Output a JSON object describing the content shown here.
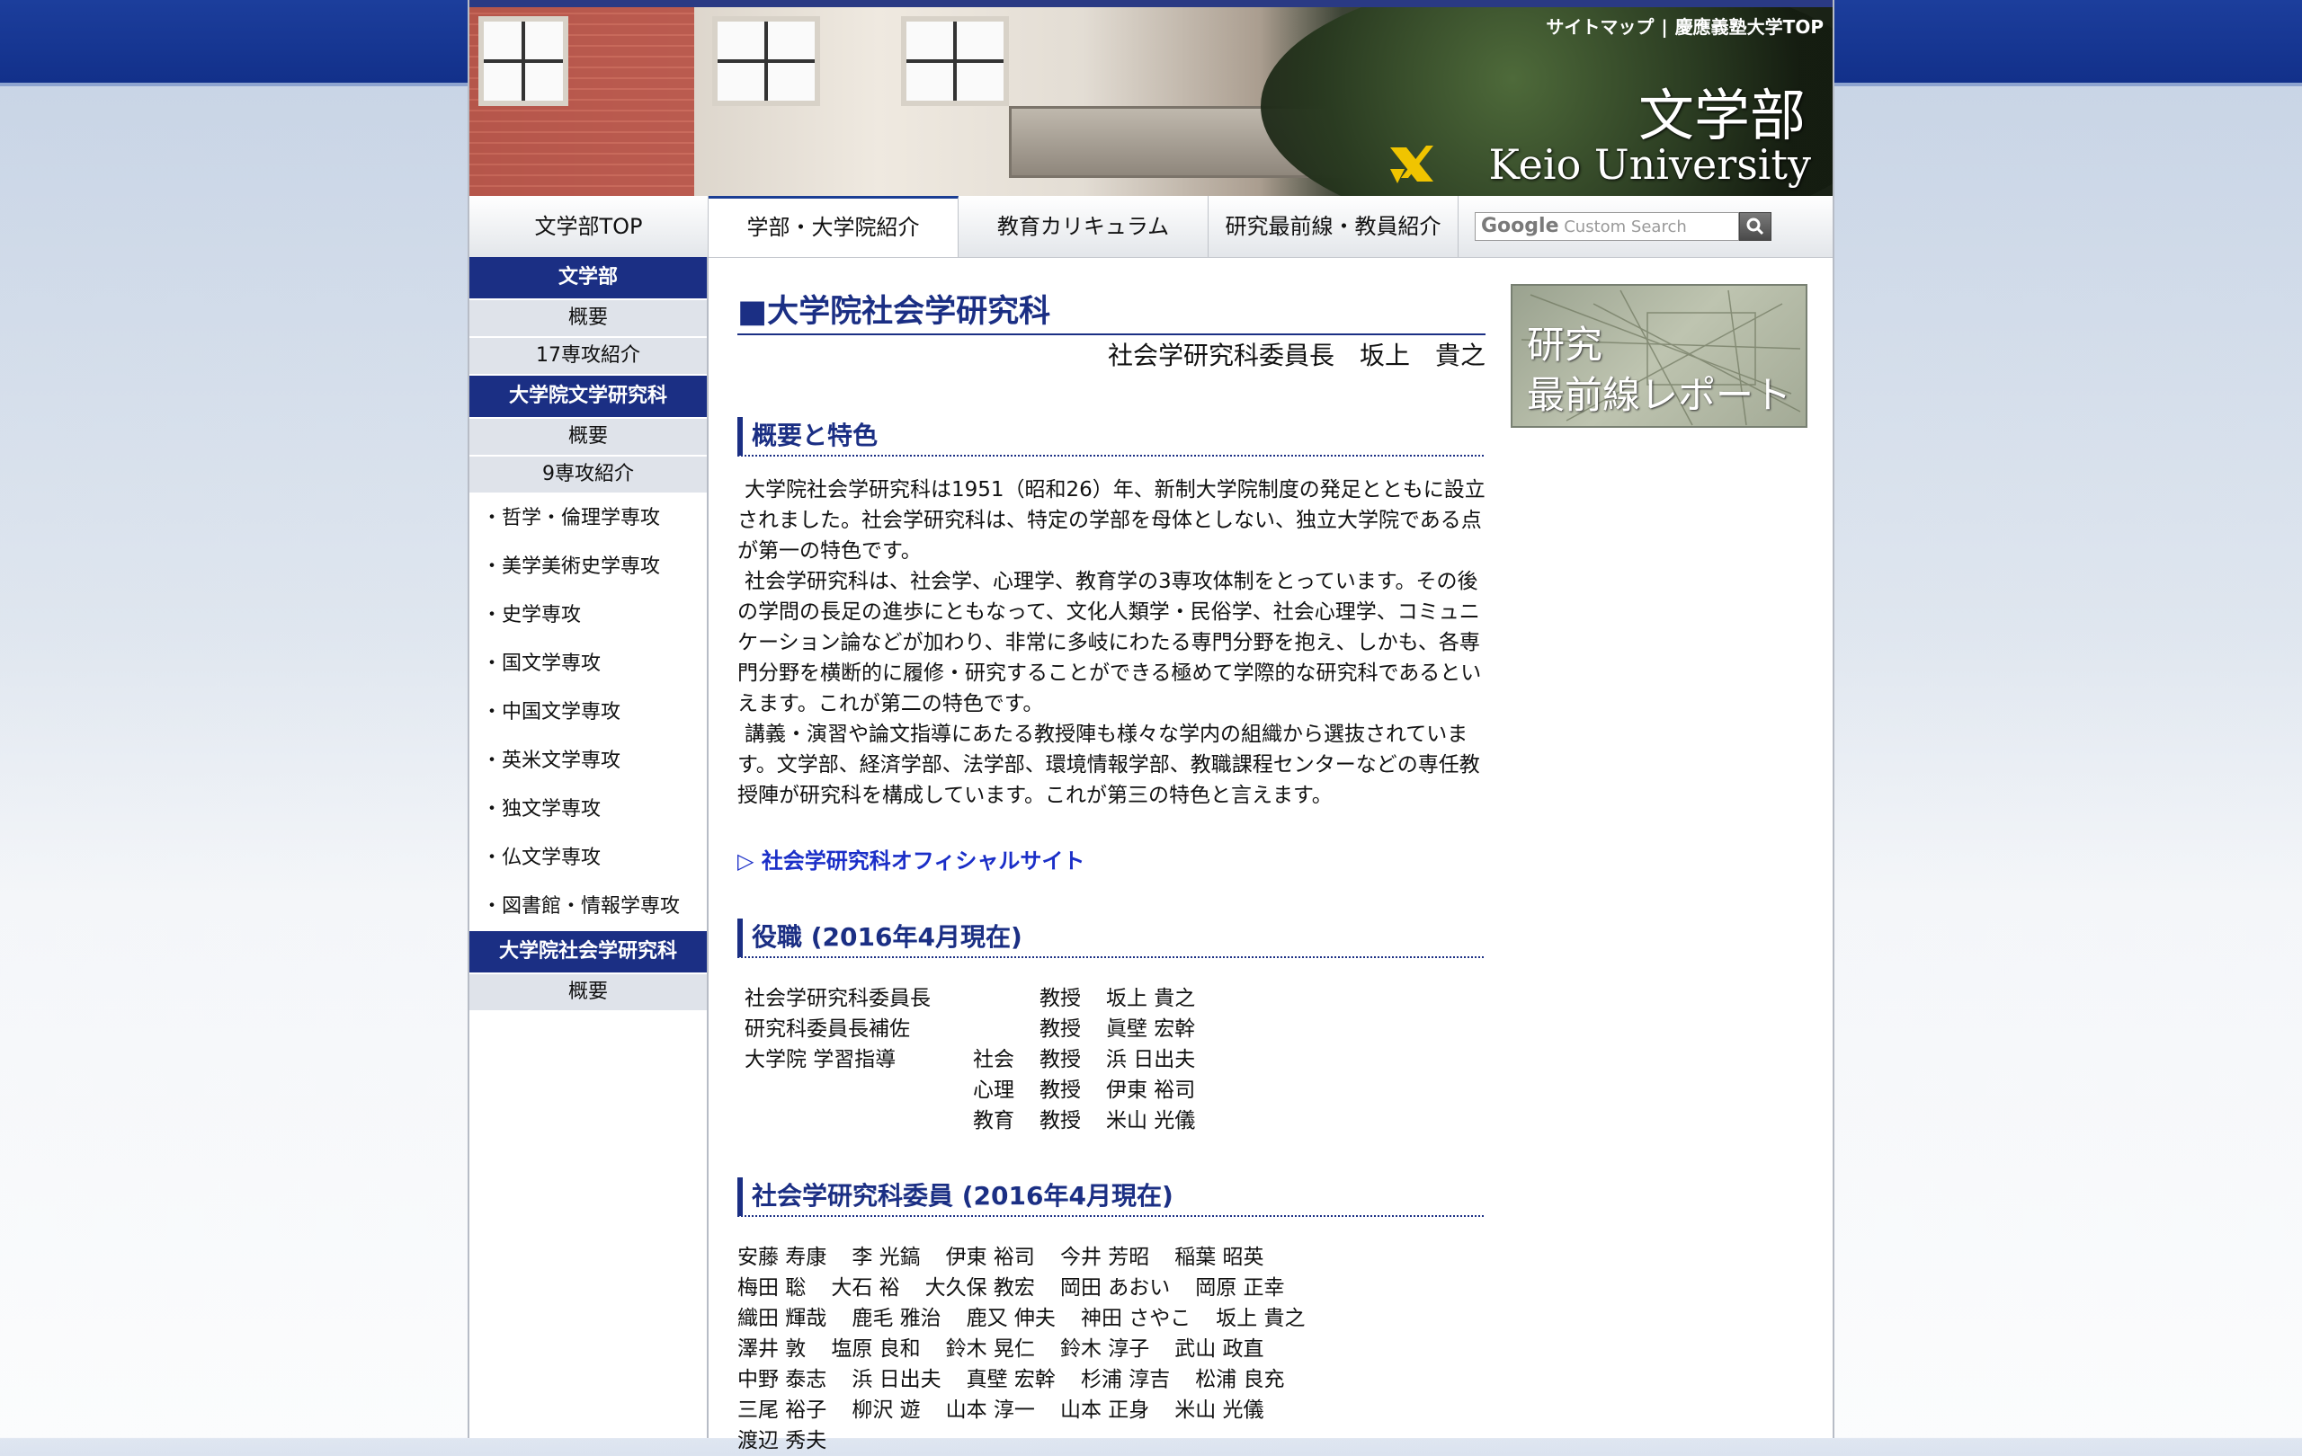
{
  "header": {
    "toplinks": [
      "サイトマップ",
      "慶應義塾大学TOP"
    ],
    "separator": "|",
    "logo_ja": "文学部",
    "logo_en": "Keio University"
  },
  "nav": {
    "items": [
      "文学部TOP",
      "学部・大学院紹介",
      "教育カリキュラム",
      "研究最前線・教員紹介"
    ],
    "active_index": 1,
    "search_brand": "Google",
    "search_placeholder": "Custom Search"
  },
  "sidebar": {
    "head1": "文学部",
    "sub1": [
      "概要",
      "17専攻紹介"
    ],
    "head2": "大学院文学研究科",
    "sub2": [
      "概要",
      "9専攻紹介"
    ],
    "majors": [
      "・哲学・倫理学専攻",
      "・美学美術史学専攻",
      "・史学専攻",
      "・国文学専攻",
      "・中国文学専攻",
      "・英米文学専攻",
      "・独文学専攻",
      "・仏文学専攻",
      "・図書館・情報学専攻"
    ],
    "head3": "大学院社会学研究科",
    "sub3": [
      "概要"
    ]
  },
  "main": {
    "title": "■大学院社会学研究科",
    "subtitle": "社会学研究科委員長　坂上　貴之",
    "section1": "概要と特色",
    "paragraphs": [
      "大学院社会学研究科は1951（昭和26）年、新制大学院制度の発足とともに設立されました。社会学研究科は、特定の学部を母体としない、独立大学院である点が第一の特色です。",
      "社会学研究科は、社会学、心理学、教育学の3専攻体制をとっています。その後の学問の長足の進歩にともなって、文化人類学・民俗学、社会心理学、コミュニケーション論などが加わり、非常に多岐にわたる専門分野を抱え、しかも、各専門分野を横断的に履修・研究することができる極めて学際的な研究科であるといえます。これが第二の特色です。",
      "講義・演習や論文指導にあたる教授陣も様々な学内の組織から選抜されています。文学部、経済学部、法学部、環境情報学部、教職課程センターなどの専任教授陣が研究科を構成しています。これが第三の特色と言えます。"
    ],
    "official_link": "▷ 社会学研究科オフィシャルサイト",
    "section2": "役職 (2016年4月現在)",
    "roles": [
      {
        "role": "社会学研究科委員長",
        "field": "",
        "rank": "教授",
        "name": "坂上 貴之"
      },
      {
        "role": "研究科委員長補佐",
        "field": "",
        "rank": "教授",
        "name": "眞壁 宏幹"
      },
      {
        "role": "大学院 学習指導",
        "field": "社会",
        "rank": "教授",
        "name": "浜 日出夫"
      },
      {
        "role": "",
        "field": "心理",
        "rank": "教授",
        "name": "伊東 裕司"
      },
      {
        "role": "",
        "field": "教育",
        "rank": "教授",
        "name": "米山 光儀"
      }
    ],
    "section3": "社会学研究科委員 (2016年4月現在)",
    "members": [
      [
        "安藤 寿康",
        "李 光鎬",
        "伊東 裕司",
        "今井 芳昭",
        "稲葉 昭英"
      ],
      [
        "梅田 聡",
        "大石 裕",
        "大久保 教宏",
        "岡田 あおい",
        "岡原 正幸"
      ],
      [
        "織田 輝哉",
        "鹿毛 雅治",
        "鹿又 伸夫",
        "神田 さやこ",
        "坂上 貴之"
      ],
      [
        "澤井 敦",
        "塩原 良和",
        "鈴木 晃仁",
        "鈴木 淳子",
        "武山 政直"
      ],
      [
        "中野 泰志",
        "浜 日出夫",
        "真壁 宏幹",
        "杉浦 淳吉",
        "松浦 良充"
      ],
      [
        "三尾 裕子",
        "柳沢 遊",
        "山本 淳一",
        "山本 正身",
        "米山 光儀"
      ],
      [
        "渡辺 秀夫"
      ]
    ]
  },
  "banner": {
    "line1": "研究",
    "line2": "最前線レポート"
  }
}
